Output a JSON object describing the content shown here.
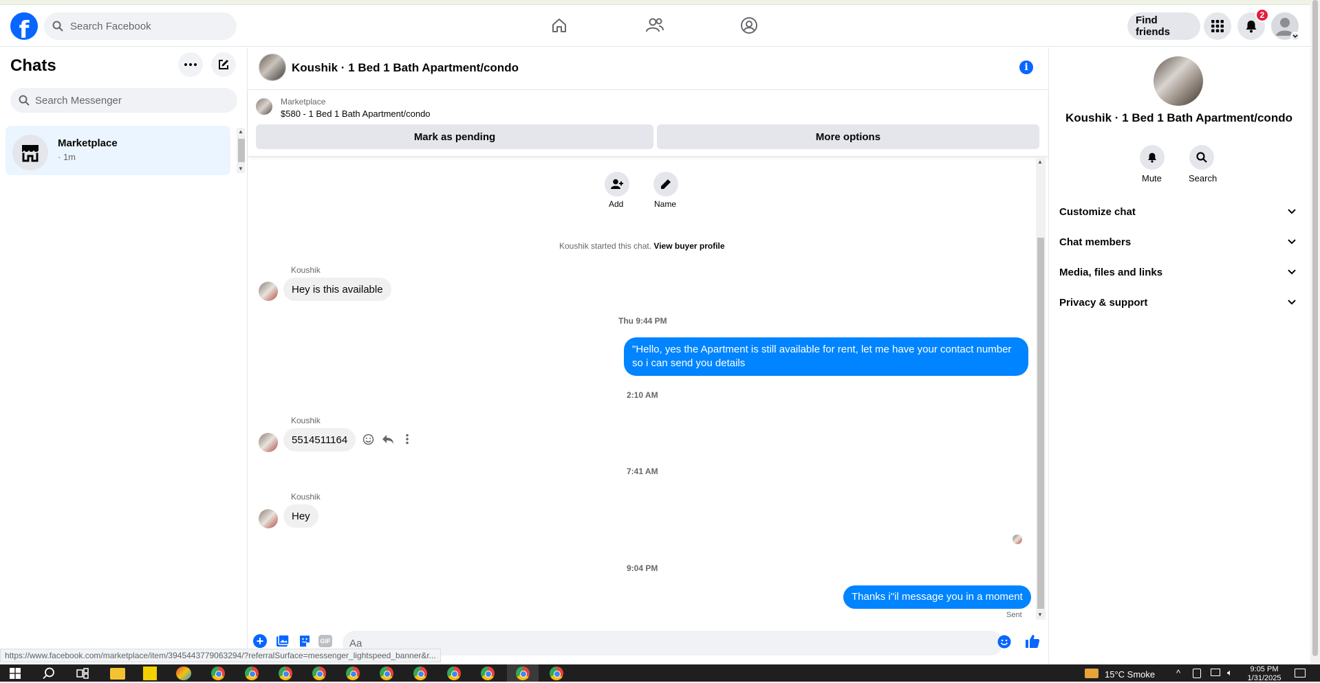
{
  "topbar": {
    "search_placeholder": "Search Facebook",
    "find_friends": "Find friends",
    "notification_count": "2"
  },
  "left": {
    "title": "Chats",
    "search_placeholder": "Search Messenger",
    "conversation": {
      "name": "Marketplace",
      "time": "· 1m"
    }
  },
  "chat": {
    "title": "Koushik · 1 Bed 1 Bath Apartment/condo",
    "marketplace_label": "Marketplace",
    "listing": "$580 - 1 Bed 1 Bath Apartment/condo",
    "mark_pending": "Mark as pending",
    "more_options": "More options",
    "add_label": "Add",
    "name_label": "Name",
    "started_text": "Koushik started this chat.",
    "view_profile": "View buyer profile",
    "messages": [
      {
        "sender": "Koushik",
        "text": "Hey is this available"
      },
      {
        "time": "Thu 9:44 PM"
      },
      {
        "text": "\"Hello, yes the Apartment is still available for rent, let me have your contact number so i can send you details"
      },
      {
        "time": "2:10 AM"
      },
      {
        "sender": "Koushik",
        "text": "5514511164"
      },
      {
        "time": "7:41 AM"
      },
      {
        "sender": "Koushik",
        "text": "Hey"
      },
      {
        "time": "9:04 PM"
      },
      {
        "text": "Thanks i\"il message you in a moment",
        "status": "Sent"
      }
    ],
    "composer_placeholder": "Aa",
    "status_url": "https://www.facebook.com/marketplace/item/3945443779063294/?referralSurface=messenger_lightspeed_banner&r..."
  },
  "right": {
    "name": "Koushik · 1 Bed 1 Bath Apartment/condo",
    "mute": "Mute",
    "search": "Search",
    "sections": [
      "Customize chat",
      "Chat members",
      "Media, files and links",
      "Privacy & support"
    ]
  },
  "taskbar": {
    "weather": "15°C  Smoke",
    "time": "9:05 PM",
    "date": "1/31/2025"
  },
  "colors": {
    "accent": "#0866ff",
    "bubble_out": "#0084ff",
    "bubble_in": "#f0f0f0"
  }
}
